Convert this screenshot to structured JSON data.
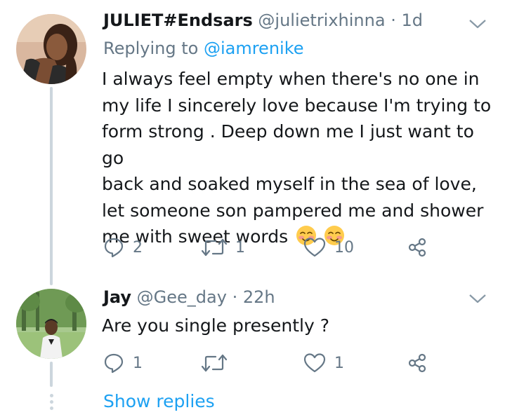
{
  "tweets": [
    {
      "display_name": "JULIET#Endsars",
      "handle": "@julietrixhinna",
      "time": "· 1d",
      "replying_prefix": "Replying to",
      "replying_to": "@iamrenike",
      "text_lines": [
        "I always feel empty when there's no one in",
        "my life I sincerely love because I'm trying to",
        "form strong . Deep down me I just want to go",
        "back and soaked myself in the sea of love,",
        "let someone son pampered me  and shower",
        "me with sweet words"
      ],
      "emoji": [
        "smiling-face-emoji",
        "smiling-face-emoji"
      ],
      "replies": "2",
      "retweets": "1",
      "likes": "10"
    },
    {
      "display_name": "Jay",
      "handle": "@Gee_day",
      "time": "· 22h",
      "text_lines": [
        "Are you single presently ?"
      ],
      "replies": "1",
      "retweets": "",
      "likes": "1"
    }
  ],
  "show_replies_label": "Show replies",
  "colors": {
    "text": "#14171a",
    "secondary": "#657786",
    "link": "#1da1f2",
    "thread_line": "#ccd6dd"
  }
}
